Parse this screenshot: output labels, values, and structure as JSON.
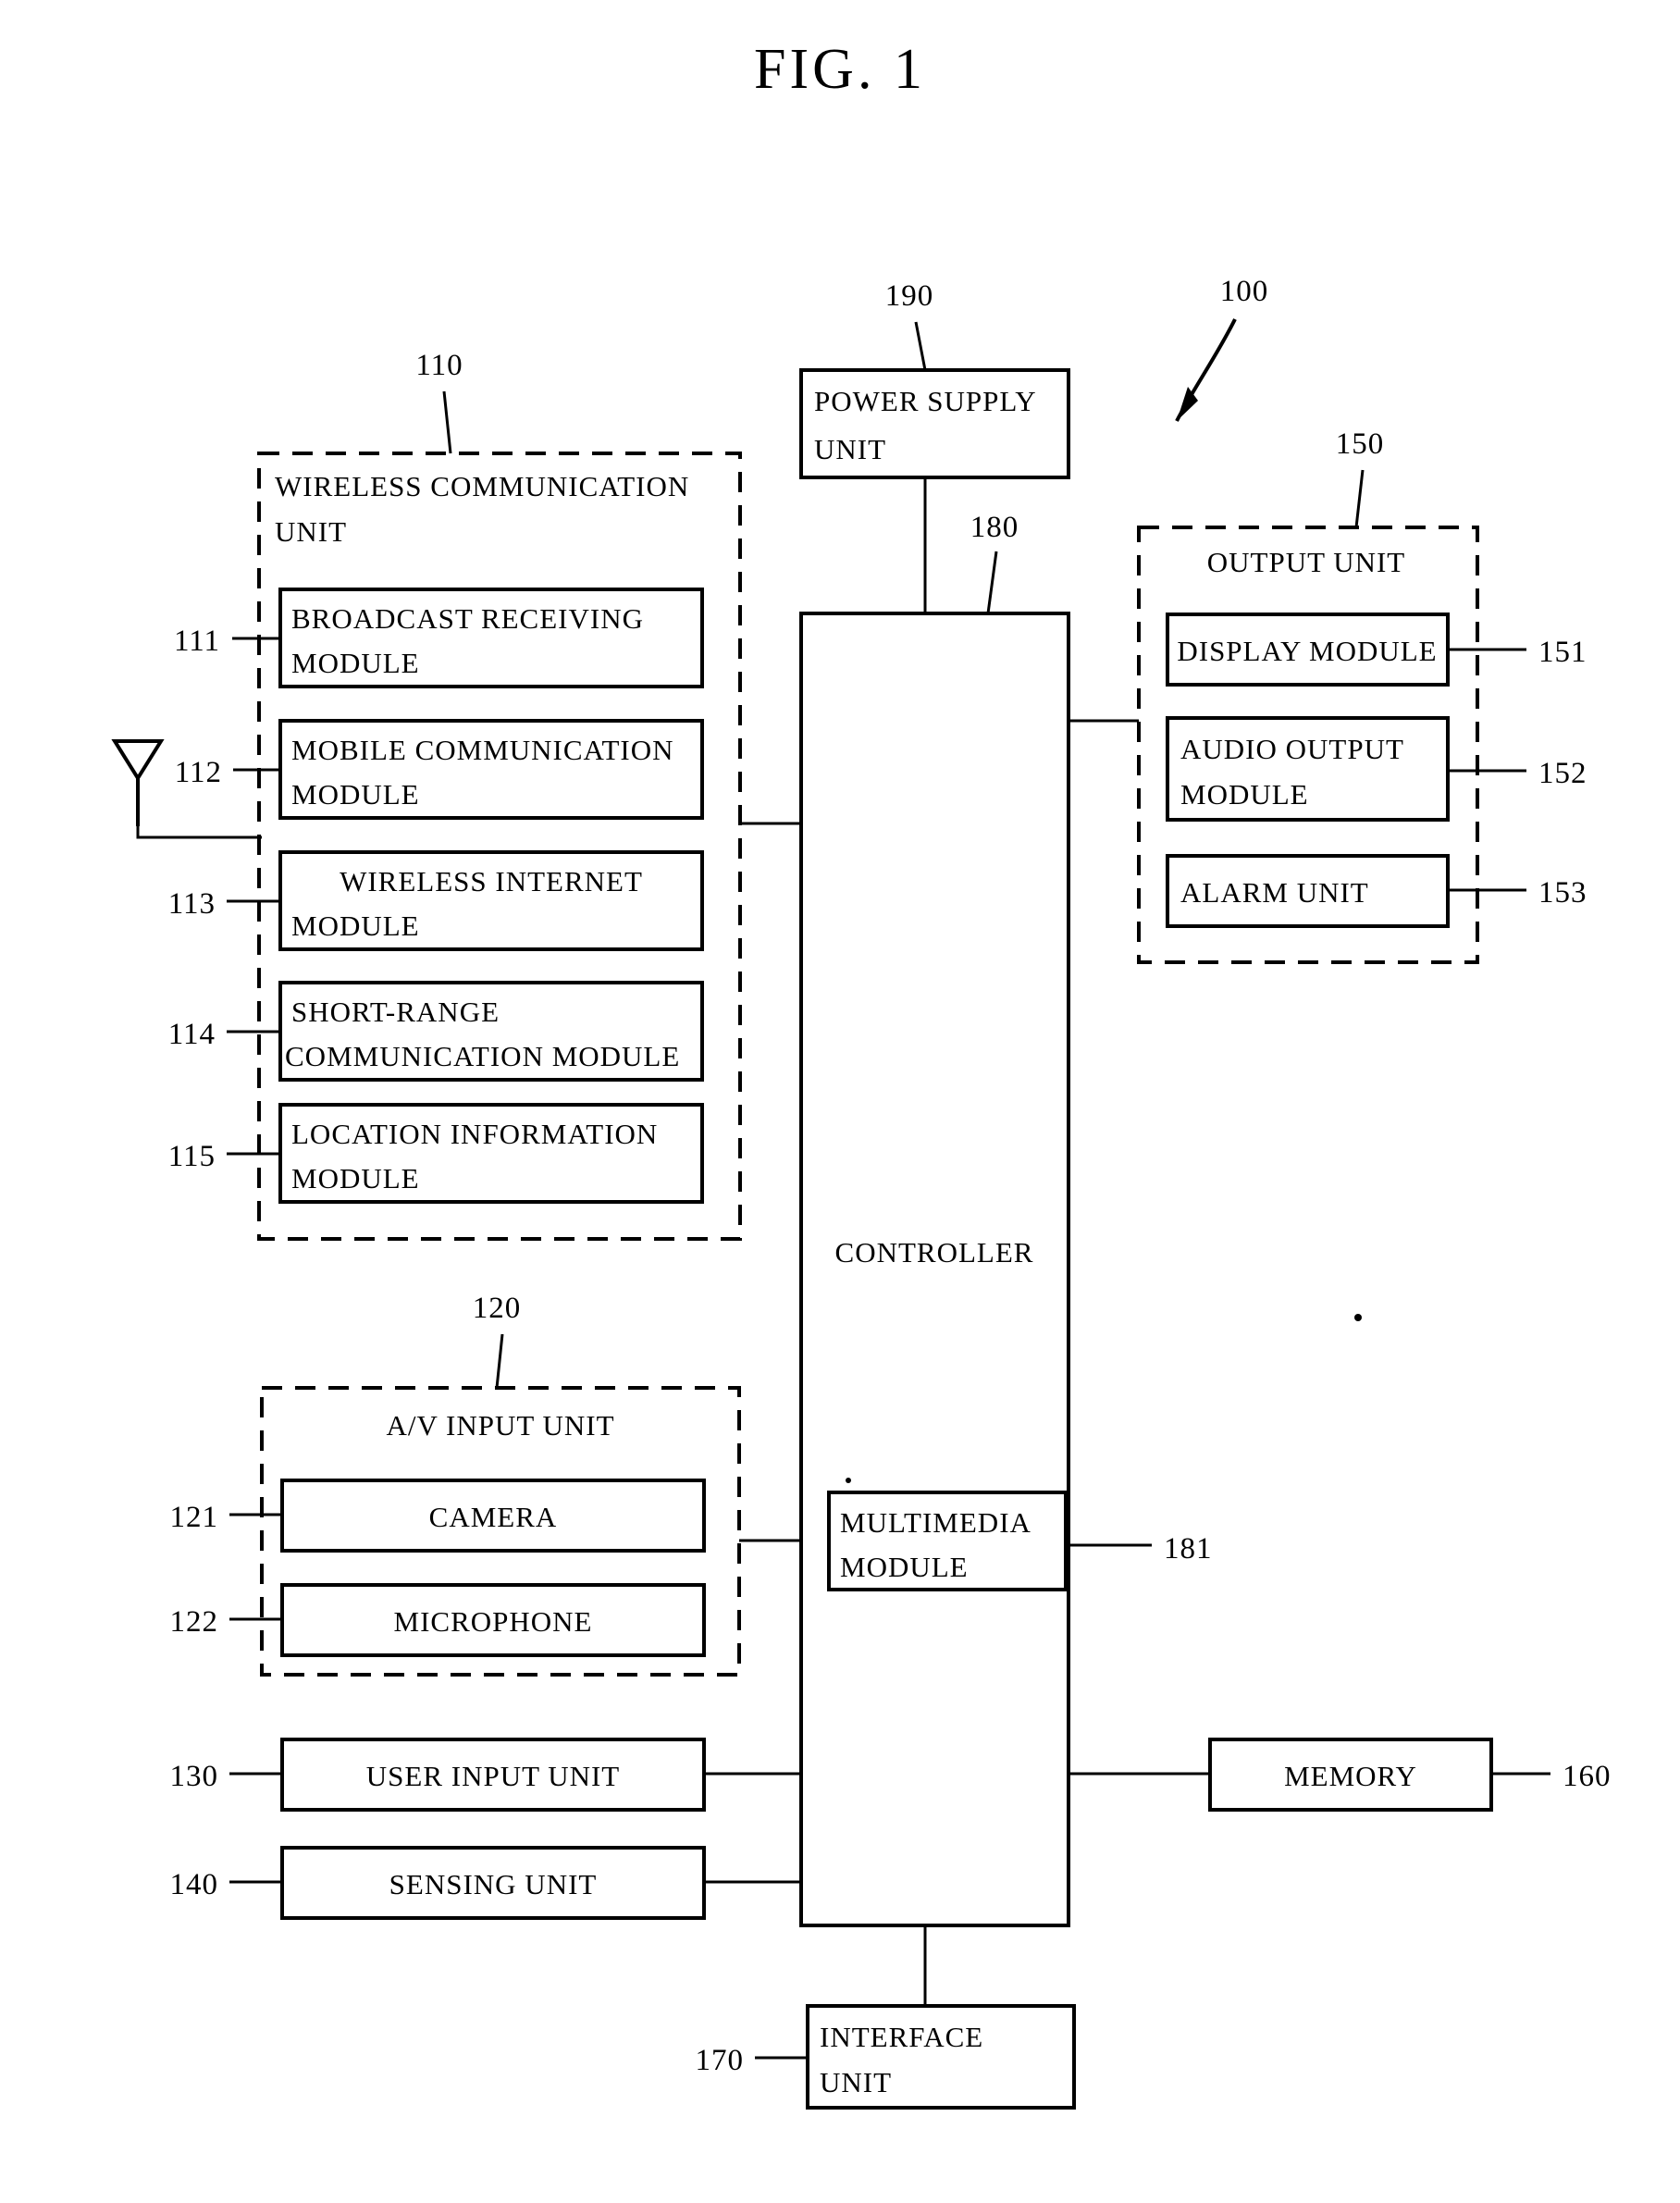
{
  "figure": {
    "title": "FIG.  1",
    "system_ref": "100"
  },
  "blocks": {
    "wireless_unit": {
      "label_line1": "WIRELESS COMMUNICATION",
      "label_line2": "UNIT",
      "ref": "110",
      "modules": [
        {
          "ref": "111",
          "line1": "BROADCAST  RECEIVING",
          "line2": "MODULE",
          "align": "left"
        },
        {
          "ref": "112",
          "line1": "MOBILE  COMMUNICATION",
          "line2": "MODULE",
          "align": "left"
        },
        {
          "ref": "113",
          "line1": "WIRELESS  INTERNET",
          "line2": "MODULE",
          "align": "mixed"
        },
        {
          "ref": "114",
          "line1": "SHORT-RANGE",
          "line2": "COMMUNICATION  MODULE",
          "align": "left"
        },
        {
          "ref": "115",
          "line1": "LOCATION  INFORMATION",
          "line2": "MODULE",
          "align": "left"
        }
      ]
    },
    "av_input_unit": {
      "label": "A/V  INPUT  UNIT",
      "ref": "120",
      "modules": [
        {
          "ref": "121",
          "label": "CAMERA"
        },
        {
          "ref": "122",
          "label": "MICROPHONE"
        }
      ]
    },
    "user_input_unit": {
      "label": "USER  INPUT  UNIT",
      "ref": "130"
    },
    "sensing_unit": {
      "label": "SENSING  UNIT",
      "ref": "140"
    },
    "output_unit": {
      "label": "OUTPUT  UNIT",
      "ref": "150",
      "modules": [
        {
          "ref": "151",
          "line1": "DISPLAY  MODULE",
          "line2": ""
        },
        {
          "ref": "152",
          "line1": "AUDIO  OUTPUT",
          "line2": "MODULE"
        },
        {
          "ref": "153",
          "line1": "ALARM  UNIT",
          "line2": ""
        }
      ]
    },
    "memory": {
      "label": "MEMORY",
      "ref": "160"
    },
    "interface_unit": {
      "line1": "INTERFACE",
      "line2": "UNIT",
      "ref": "170"
    },
    "controller": {
      "label": "CONTROLLER",
      "ref": "180",
      "submodule": {
        "line1": "MULTIMEDIA",
        "line2": "MODULE",
        "ref": "181"
      }
    },
    "power_supply_unit": {
      "line1": "POWER SUPPLY",
      "line2": "UNIT",
      "ref": "190"
    }
  },
  "icons": {
    "antenna": "antenna-icon"
  }
}
